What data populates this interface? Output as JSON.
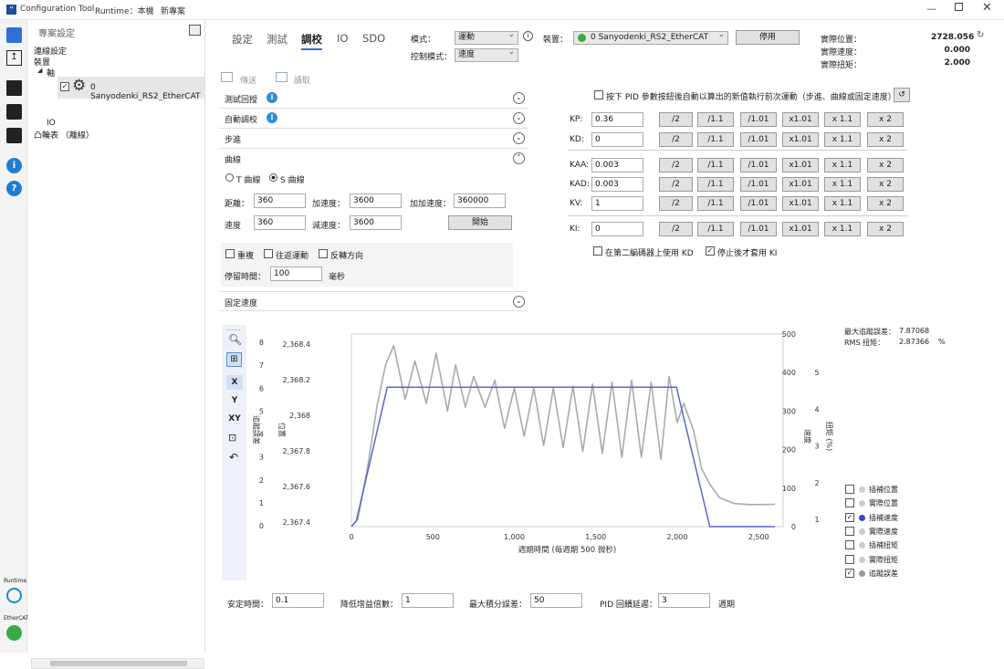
{
  "window": {
    "app_name": "Configuration Tool",
    "runtime_label": "Runtime：本機",
    "project_label": "新專案"
  },
  "sidebar_bottom": {
    "runtime": "Runtime",
    "ethercat": "EtherCAT"
  },
  "tree": {
    "header": "專案設定",
    "items": [
      "連線設定",
      "裝置",
      "軸"
    ],
    "device": "0  Sanyodenki_RS2_EtherCAT",
    "io": "IO",
    "cam": "凸輪表 （離線）"
  },
  "tabs": [
    "設定",
    "測試",
    "調校",
    "IO",
    "SDO"
  ],
  "controls": {
    "mode_label": "模式：",
    "mode_value": "運動",
    "control_mode_label": "控制模式：",
    "control_mode_value": "速度",
    "device_label": "裝置：",
    "device_value": "0  Sanyodenki_RS2_EtherCAT",
    "disable_button": "停用"
  },
  "readouts": [
    {
      "label": "實際位置：",
      "value": "2728.056"
    },
    {
      "label": "實際速度：",
      "value": "0.000"
    },
    {
      "label": "實際扭矩：",
      "value": "2.000"
    }
  ],
  "toolbar": {
    "write": "傳送",
    "read": "讀取"
  },
  "sections": {
    "test_loop": "測試回授",
    "auto_tune": "自動調校",
    "step": "步進",
    "curve": "曲線",
    "fixed_speed": "固定速度"
  },
  "curve": {
    "t_curve": "T 曲線",
    "s_curve": "S 曲線",
    "distance_label": "距離：",
    "distance": "360",
    "accel_label": "加速度：",
    "accel": "3600",
    "jerk_label": "加加速度：",
    "jerk": "360000",
    "speed_label": "速度",
    "speed": "360",
    "decel_label": "減速度：",
    "decel": "3600",
    "start_button": "開始",
    "repeat": "重複",
    "reciprocate": "往返運動",
    "reverse": "反轉方向",
    "dwell_label": "停留時間：",
    "dwell": "100",
    "dwell_unit": "毫秒"
  },
  "pid": {
    "auto_rerun": "按下 PID 參數按鈕後自動以算出的新值執行前次運動（步進、曲線或固定速度）",
    "buttons": [
      "/2",
      "/1.1",
      "/1.01",
      "x1.01",
      "x 1.1",
      "x 2"
    ],
    "rows": [
      {
        "label": "KP:",
        "value": "0.36"
      },
      {
        "label": "KD:",
        "value": "0"
      },
      {
        "label": "KAA:",
        "value": "0.003"
      },
      {
        "label": "KAD:",
        "value": "0.003"
      },
      {
        "label": "KV:",
        "value": "1"
      },
      {
        "label": "KI:",
        "value": "0"
      }
    ],
    "kd_second_encoder": "在第二編碼器上使用 KD",
    "ki_after_stop": "停止後才套用 KI"
  },
  "graph_tools": [
    "X",
    "Y",
    "XY"
  ],
  "chart_data": {
    "type": "line",
    "xlabel": "週期時間 (每週期 500 微秒)",
    "ylabel": "位置",
    "ylabel_left2": "追蹤誤差",
    "ylabel_right1": "速度",
    "ylabel_right2": "扭矩 (%)",
    "xticks": [
      "0",
      "500",
      "1,000",
      "1,500",
      "2,000",
      "2,500"
    ],
    "yticks_left1": [
      "0",
      "1",
      "2",
      "3",
      "4",
      "5",
      "6",
      "7",
      "8"
    ],
    "yticks_left2": [
      "2,367.4",
      "2,367.6",
      "2,367.8",
      "2,368",
      "2,368.2",
      "2,368.4"
    ],
    "yticks_right1": [
      "0",
      "100",
      "200",
      "300",
      "400",
      "500"
    ],
    "yticks_right2": [
      "1",
      "2",
      "3",
      "4",
      "5"
    ],
    "xlim": [
      0,
      2650
    ],
    "ylim_speed": [
      0,
      500
    ],
    "series": [
      {
        "name": "插補速度",
        "color": "#5b63d6",
        "x": [
          0,
          30,
          220,
          1995,
          2200,
          2600
        ],
        "values": [
          0,
          15,
          362,
          362,
          0,
          0
        ]
      },
      {
        "name": "追蹤誤差",
        "color": "#aaaaaa",
        "x": [
          0,
          40,
          100,
          160,
          210,
          260,
          330,
          390,
          460,
          520,
          590,
          640,
          700,
          750,
          820,
          880,
          940,
          1000,
          1060,
          1120,
          1180,
          1240,
          1300,
          1360,
          1420,
          1480,
          1540,
          1600,
          1660,
          1720,
          1780,
          1840,
          1900,
          1950,
          2000,
          2040,
          2100,
          2150,
          2200,
          2260,
          2350,
          2450,
          2600
        ],
        "values": [
          0,
          20,
          155,
          320,
          420,
          470,
          330,
          430,
          320,
          450,
          300,
          420,
          310,
          390,
          310,
          380,
          255,
          360,
          235,
          360,
          210,
          360,
          205,
          365,
          195,
          370,
          190,
          375,
          180,
          380,
          180,
          375,
          175,
          390,
          270,
          320,
          250,
          150,
          110,
          75,
          60,
          57,
          58
        ]
      }
    ]
  },
  "stats": {
    "max_error_label": "最大追蹤誤差：",
    "max_error": "7.87068",
    "rms_torque_label": "RMS 扭矩：",
    "rms_torque": "2.87366",
    "rms_unit": "%"
  },
  "legend": [
    {
      "label": "插補位置",
      "checked": false,
      "color": "#cccccc"
    },
    {
      "label": "實際位置",
      "checked": false,
      "color": "#cccccc"
    },
    {
      "label": "插補速度",
      "checked": true,
      "color": "#3b45c8"
    },
    {
      "label": "實際速度",
      "checked": false,
      "color": "#cccccc"
    },
    {
      "label": "插補扭矩",
      "checked": false,
      "color": "#cccccc"
    },
    {
      "label": "實際扭矩",
      "checked": false,
      "color": "#cccccc"
    },
    {
      "label": "追蹤誤差",
      "checked": true,
      "color": "#999999"
    }
  ],
  "bottom": {
    "settle_label": "安定時間：",
    "settle": "0.1",
    "gain_label": "降低增益倍數：",
    "gain": "1",
    "maxint_label": "最大積分誤差：",
    "maxint": "50",
    "delay_label": "PID 回饋延遲：",
    "delay": "3",
    "delay_unit": "週期"
  }
}
